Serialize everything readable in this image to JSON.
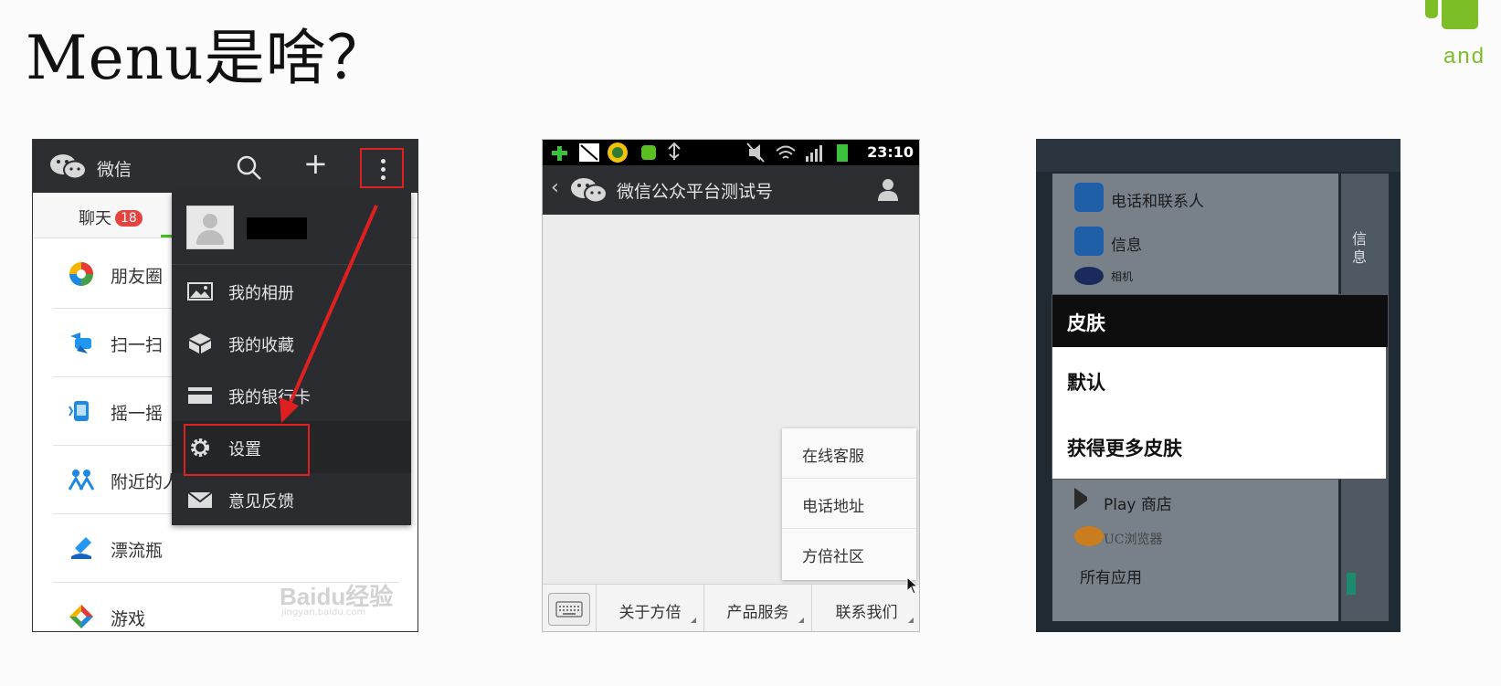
{
  "slide": {
    "title": "Menu是啥？",
    "logo_text": "and",
    "accent_color": "#7cbd28",
    "annotation_color": "#e02020"
  },
  "wechat_main": {
    "app_title": "微信",
    "icons": [
      "wechat-logo-icon",
      "search-icon",
      "plus-icon",
      "more-vertical-icon"
    ],
    "tab_chat": "聊天",
    "tab_badge": "18",
    "list": [
      {
        "label": "朋友圈",
        "icon": "moments-icon"
      },
      {
        "label": "扫一扫",
        "icon": "scan-icon"
      },
      {
        "label": "摇一摇",
        "icon": "shake-icon"
      },
      {
        "label": "附近的人",
        "icon": "nearby-people-icon"
      },
      {
        "label": "漂流瓶",
        "icon": "drift-bottle-icon"
      },
      {
        "label": "游戏",
        "icon": "games-icon"
      }
    ],
    "menu": [
      {
        "label": "我的相册",
        "icon": "photo-album-icon"
      },
      {
        "label": "我的收藏",
        "icon": "favorites-cube-icon"
      },
      {
        "label": "我的银行卡",
        "icon": "bank-card-icon"
      },
      {
        "label": "设置",
        "icon": "gear-icon"
      },
      {
        "label": "意见反馈",
        "icon": "envelope-icon"
      }
    ],
    "watermark": "Baidu经验",
    "watermark_url": "jingyan.baidu.com"
  },
  "wechat_public": {
    "status_time": "23:10",
    "title": "微信公众平台测试号",
    "popup": [
      "在线客服",
      "电话地址",
      "方倍社区"
    ],
    "bottom_tabs": [
      "关于方倍",
      "产品服务",
      "联系我们"
    ]
  },
  "skin_dialog": {
    "background_items": [
      "电话和联系人",
      "信息",
      "相机",
      "Play 商店",
      "UC浏览器",
      "所有应用"
    ],
    "side_text": "信息",
    "title": "皮肤",
    "options": [
      "默认",
      "获得更多皮肤"
    ]
  }
}
